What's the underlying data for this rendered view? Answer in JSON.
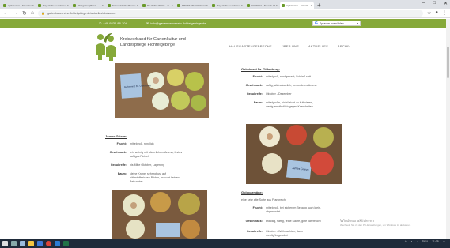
{
  "browser": {
    "tabs": [
      {
        "title": "Apfelsorten - Aktuelles",
        "active": false
      },
      {
        "title": "Bayerischer Landesver.",
        "active": false
      },
      {
        "title": "Obstgartenpflanz.",
        "active": false
      },
      {
        "title": "Schneidekalte Pflanze",
        "active": false
      },
      {
        "title": "Die Schneidkalte - vs",
        "active": false
      },
      {
        "title": "KROSS Obst Effizienz",
        "active": false
      },
      {
        "title": "Bayerischer Landesver.",
        "active": false
      },
      {
        "title": "CORONA - Aktuelle Inf.",
        "active": false
      },
      {
        "title": "Apfelsorten - Aktuelle",
        "active": true
      }
    ],
    "url": "gartenbauvereine-fichtelgebirge.de/aktuelles/obstsorten"
  },
  "topbar": {
    "phone": "+49 9232 88-104",
    "email": "info@gartenbauverein-fichtelgebirge.de",
    "language_label": "Sprache auswählen"
  },
  "header": {
    "org_line1": "Kreisverband für Gartenkultur und",
    "org_line2": "Landespflege Fichtelgebirge",
    "nav": [
      "HAUSGARTENGEBRECHE",
      "ÜBER UNS",
      "AKTUELLES",
      "ARCHIV"
    ]
  },
  "varieties": {
    "oldenburg": {
      "title": "Geheimrat Dr. Oldenburg:",
      "rows": [
        {
          "k": "Frucht:",
          "v": "mittelgroß, rundgebaut; Schließ satt"
        },
        {
          "k": "Geschmack:",
          "v": "saftig, süß-säuerlich, besonderes Aroma"
        },
        {
          "k": "Genußreife:",
          "v": "Oktober - Dezember"
        },
        {
          "k": "Baum:",
          "v": "mittelgroße, nicht leicht zu kultivieren, wenig empfindlich gegen Krankheiten"
        }
      ]
    },
    "grieve": {
      "title": "James Grieve:",
      "rows": [
        {
          "k": "Frucht:",
          "v": "mittelgroß, rundlich"
        },
        {
          "k": "Geschmack:",
          "v": "fein weinig mit säuerlichem Aroma, festes saftiges Fleisch"
        },
        {
          "k": "Genußreife:",
          "v": "bis Mitte Oktober, Lagerung"
        },
        {
          "k": "Baum:",
          "v": "kleine Krone, sehr robust auf nährstoffreichen Böden, braucht keinen Befruchter"
        }
      ]
    },
    "goldparmaene": {
      "title": "Goldparmäne:",
      "intro": "eine sehr alte Sorte aus Frankreich",
      "rows": [
        {
          "k": "Frucht:",
          "v": "mittelgroß, bei sicherem Behang auch klein, abgerundet"
        },
        {
          "k": "Geschmack:",
          "v": "knackig, saftig, feine Säure, gute Tafelfrucht"
        },
        {
          "k": "Genußreife:",
          "v": "Oktober - Weihnachten, dann mehlig/Lagerobst"
        }
      ]
    },
    "sign_text": "Geheimrat Dr. Oldenburg",
    "sign_text2": "James Grieve"
  },
  "watermark": {
    "line1": "Windows aktivieren",
    "line2": "Wechseln Sie zu den PC-Einstellungen, um Windows zu aktivieren."
  },
  "tray": {
    "time": "11:05",
    "lang": "DEU"
  },
  "colors": {
    "brand_green": "#86a93a"
  }
}
